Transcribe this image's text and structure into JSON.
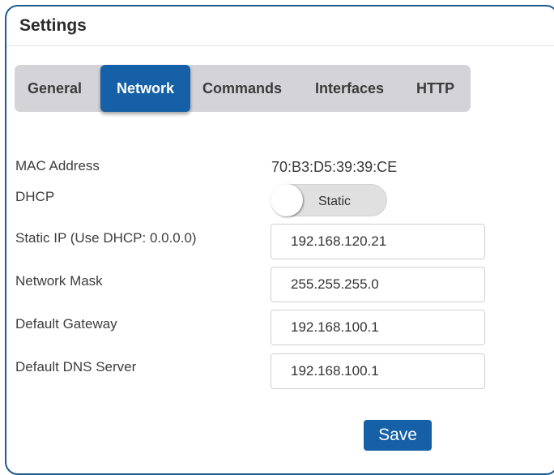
{
  "panel": {
    "title": "Settings"
  },
  "tabs": [
    {
      "label": "General",
      "active": false
    },
    {
      "label": "Network",
      "active": true
    },
    {
      "label": "Commands",
      "active": false
    },
    {
      "label": "Interfaces",
      "active": false
    },
    {
      "label": "HTTP",
      "active": false
    }
  ],
  "fields": {
    "mac": {
      "label": "MAC Address",
      "value": "70:B3:D5:39:39:CE"
    },
    "dhcp": {
      "label": "DHCP",
      "state": "Static"
    },
    "static_ip": {
      "label": "Static IP (Use DHCP: 0.0.0.0)",
      "value": "192.168.120.21"
    },
    "netmask": {
      "label": "Network Mask",
      "value": "255.255.255.0"
    },
    "gateway": {
      "label": "Default Gateway",
      "value": "192.168.100.1"
    },
    "dns": {
      "label": "Default DNS Server",
      "value": "192.168.100.1"
    }
  },
  "actions": {
    "save_label": "Save"
  },
  "colors": {
    "accent": "#1560a6",
    "panel_border": "#1b5c8f",
    "tabbar_bg": "#d3d3d8"
  }
}
